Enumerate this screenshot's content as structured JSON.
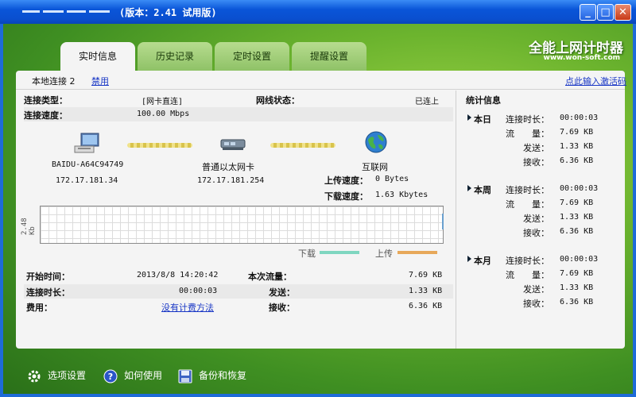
{
  "window": {
    "title": "(版本：2.41 试用版)",
    "minimize": "_",
    "maximize": "□",
    "close": "✕"
  },
  "brand": {
    "name": "全能上网计时器",
    "site": "www.won-soft.com"
  },
  "tabs": [
    {
      "label": "实时信息"
    },
    {
      "label": "历史记录"
    },
    {
      "label": "定时设置"
    },
    {
      "label": "提醒设置"
    }
  ],
  "subbar": {
    "connection": "本地连接 2",
    "disable_link": "禁用",
    "register_link": "点此输入激活码"
  },
  "info": {
    "conn_type_label": "连接类型：",
    "conn_type_value": "[网卡直连]",
    "line_state_label": "网线状态：",
    "line_state_value": "已连上",
    "speed_label": "连接速度：",
    "speed_value": "100.00 Mbps"
  },
  "diagram": {
    "computer_name": "BAIDU-A64C94749",
    "computer_ip": "172.17.181.34",
    "nic_name": "普通以太网卡",
    "nic_ip": "172.17.181.254",
    "internet_name": "互联网",
    "upload_label": "上传速度：",
    "upload_value": "0 Bytes",
    "download_label": "下载速度：",
    "download_value": "1.63 Kbytes"
  },
  "graph": {
    "axis_label": "2.48 Kb",
    "legend_download": "下载",
    "legend_upload": "上传",
    "download_color": "#7fd6c0",
    "upload_color": "#e7a85a"
  },
  "summary": {
    "start_label": "开始时间：",
    "start_value": "2013/8/8 14:20:42",
    "duration_label": "连接时长：",
    "duration_value": "00:00:03",
    "fee_label": "费用：",
    "fee_link": "没有计费方法",
    "traffic_label": "本次流量：",
    "traffic_value": "7.69 KB",
    "sent_label": "发送：",
    "sent_value": "1.33 KB",
    "recv_label": "接收：",
    "recv_value": "6.36 KB"
  },
  "stats": {
    "title": "统计信息",
    "sections": [
      {
        "name": "本日",
        "rows": [
          {
            "k": "连接时长：",
            "v": "00:00:03"
          },
          {
            "k": "流　　量：",
            "v": "7.69 KB"
          },
          {
            "k": "发送：",
            "v": "1.33 KB"
          },
          {
            "k": "接收：",
            "v": "6.36 KB"
          }
        ]
      },
      {
        "name": "本周",
        "rows": [
          {
            "k": "连接时长：",
            "v": "00:00:03"
          },
          {
            "k": "流　　量：",
            "v": "7.69 KB"
          },
          {
            "k": "发送：",
            "v": "1.33 KB"
          },
          {
            "k": "接收：",
            "v": "6.36 KB"
          }
        ]
      },
      {
        "name": "本月",
        "rows": [
          {
            "k": "连接时长：",
            "v": "00:00:03"
          },
          {
            "k": "流　　量：",
            "v": "7.69 KB"
          },
          {
            "k": "发送：",
            "v": "1.33 KB"
          },
          {
            "k": "接收：",
            "v": "6.36 KB"
          }
        ]
      }
    ]
  },
  "footer": {
    "options": "选项设置",
    "help": "如何使用",
    "backup": "备份和恢复"
  }
}
